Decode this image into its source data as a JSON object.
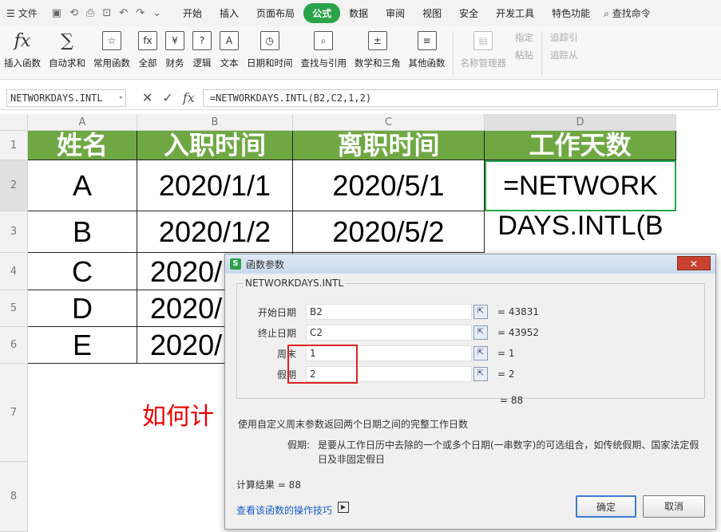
{
  "menubar": {
    "file_label": "文件",
    "tabs": [
      "开始",
      "插入",
      "页面布局",
      "公式",
      "数据",
      "审阅",
      "视图",
      "安全",
      "开发工具",
      "特色功能"
    ],
    "active_tab": "公式",
    "search_label": "查找命令"
  },
  "ribbon": {
    "buttons": [
      {
        "label": "插入函数",
        "icon": "fx-icon"
      },
      {
        "label": "自动求和",
        "icon": "sigma-icon"
      },
      {
        "label": "常用函数",
        "icon": "star-function-icon"
      },
      {
        "label": "全部",
        "icon": "all-functions-icon"
      },
      {
        "label": "财务",
        "icon": "finance-icon"
      },
      {
        "label": "逻辑",
        "icon": "logic-icon"
      },
      {
        "label": "文本",
        "icon": "text-icon"
      },
      {
        "label": "日期和时间",
        "icon": "clock-icon"
      },
      {
        "label": "查找与引用",
        "icon": "lookup-icon"
      },
      {
        "label": "数学和三角",
        "icon": "math-icon"
      },
      {
        "label": "其他函数",
        "icon": "more-functions-icon"
      },
      {
        "label": "名称管理器",
        "icon": "name-manager-icon"
      }
    ],
    "small": [
      "指定",
      "粘贴",
      "追踪引",
      "追踪从"
    ]
  },
  "formula_bar": {
    "name_box": "NETWORKDAYS.INTL",
    "formula": "=NETWORKDAYS.INTL(B2,C2,1,2)"
  },
  "sheet": {
    "columns": [
      "A",
      "B",
      "C",
      "D"
    ],
    "rows": [
      "1",
      "2",
      "3",
      "4",
      "5",
      "6",
      "7",
      "8"
    ],
    "header": [
      "姓名",
      "入职时间",
      "离职时间",
      "工作天数"
    ],
    "data": [
      [
        "A",
        "2020/1/1",
        "2020/5/1",
        "=NETWORK"
      ],
      [
        "B",
        "2020/1/2",
        "2020/5/2",
        "DAYS.INTL(B"
      ],
      [
        "C",
        "2020/",
        "",
        ""
      ],
      [
        "D",
        "2020/",
        "",
        ""
      ],
      [
        "E",
        "2020/",
        "",
        ""
      ]
    ],
    "caption": "如何计"
  },
  "dialog": {
    "title": "函数参数",
    "func_name": "NETWORKDAYS.INTL",
    "args": [
      {
        "label": "开始日期",
        "value": "B2",
        "result": "= 43831"
      },
      {
        "label": "终止日期",
        "value": "C2",
        "result": "= 43952"
      },
      {
        "label": "周末",
        "value": "1",
        "result": "= 1"
      },
      {
        "label": "假期",
        "value": "2",
        "result": "= 2"
      }
    ],
    "total": "= 88",
    "description": "使用自定义周末参数返回两个日期之间的完整工作日数",
    "param_name": "假期:",
    "param_desc_1": "是要从工作日历中去除的一个或多个日期(一串数字)的可选组合，如传统假期、国家法定假",
    "param_desc_2": "日及非固定假日",
    "calc_result": "计算结果 = 88",
    "help_link": "查看该函数的操作技巧",
    "ok_label": "确定",
    "cancel_label": "取消"
  }
}
